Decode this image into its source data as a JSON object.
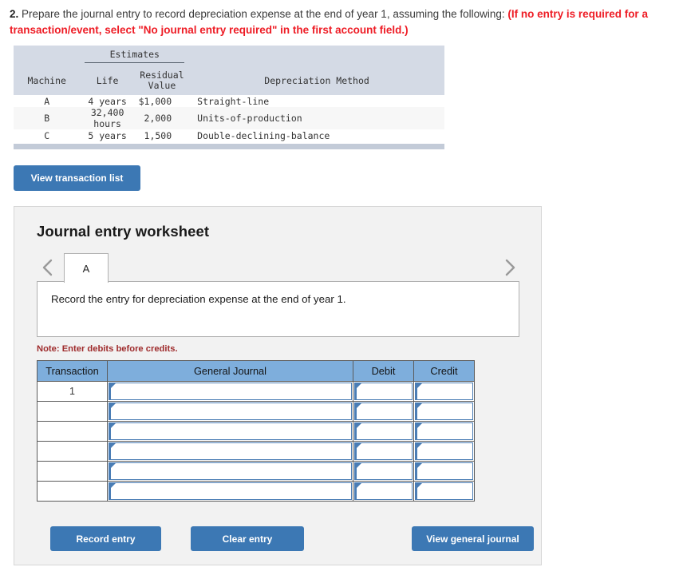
{
  "question": {
    "number": "2.",
    "main_text": "Prepare the journal entry to record depreciation expense at the end of year 1, assuming the following:",
    "red_text": "(If no entry is required for a transaction/event, select \"No journal entry required\" in the first account field.)",
    "red_color": "#ee1c25"
  },
  "estimates_table": {
    "group_header": "Estimates",
    "columns": [
      "Machine",
      "Life",
      "Residual Value",
      "Depreciation Method"
    ],
    "column_residual_line1": "Residual",
    "column_residual_line2": "Value",
    "rows": [
      {
        "machine": "A",
        "life": "4 years",
        "residual": "$1,000",
        "method": "Straight-line"
      },
      {
        "machine": "B",
        "life": "32,400 hours",
        "residual": "2,000",
        "method": "Units-of-production"
      },
      {
        "machine": "C",
        "life": "5 years",
        "residual": "1,500",
        "method": "Double-declining-balance"
      }
    ]
  },
  "view_transaction_button": {
    "label": "View transaction list"
  },
  "worksheet": {
    "title": "Journal entry worksheet",
    "prev_icon": "chevron-left-icon",
    "next_icon": "chevron-right-icon",
    "tabs": [
      {
        "label": "A",
        "active": true
      }
    ],
    "instruction": "Record the entry for depreciation expense at the end of year 1.",
    "note": "Note: Enter debits before credits.",
    "journal_table": {
      "headers": [
        "Transaction",
        "General Journal",
        "Debit",
        "Credit"
      ],
      "rows": [
        {
          "transaction": "1",
          "general_journal": "",
          "debit": "",
          "credit": ""
        },
        {
          "transaction": "",
          "general_journal": "",
          "debit": "",
          "credit": ""
        },
        {
          "transaction": "",
          "general_journal": "",
          "debit": "",
          "credit": ""
        },
        {
          "transaction": "",
          "general_journal": "",
          "debit": "",
          "credit": ""
        },
        {
          "transaction": "",
          "general_journal": "",
          "debit": "",
          "credit": ""
        },
        {
          "transaction": "",
          "general_journal": "",
          "debit": "",
          "credit": ""
        }
      ]
    },
    "buttons": {
      "record": "Record entry",
      "clear": "Clear entry",
      "view_general_journal": "View general journal"
    }
  },
  "colors": {
    "button_blue": "#3c78b4",
    "table_header_blue": "#7eaedc",
    "estimates_header": "#d4dae5",
    "note_red": "#9e2a2b"
  }
}
